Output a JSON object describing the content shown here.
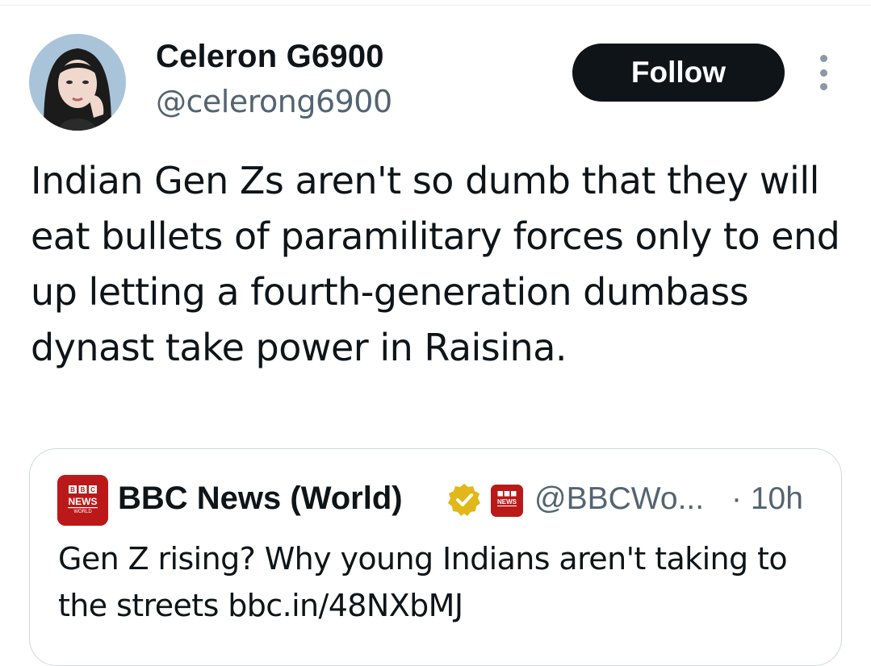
{
  "tweet": {
    "author": {
      "display_name": "Celeron G6900",
      "handle": "@celerong6900"
    },
    "follow_label": "Follow",
    "more_icon": "more-vertical-icon",
    "text": "Indian Gen Zs aren't so dumb that they will eat bullets of paramilitary forces only to end up letting a fourth-generation dumbass dynast take power in Raisina."
  },
  "quoted_tweet": {
    "author": {
      "display_name": "BBC News (World)",
      "handle": "@BBCWo...",
      "verified_icon": "gold-verified-badge-icon"
    },
    "logo_lettering": [
      "BBC",
      "NEWS",
      "WORLD"
    ],
    "timestamp": "· 10h",
    "text": "Gen Z rising? Why young Indians aren't taking to the streets bbc.in/48NXbMJ"
  },
  "colors": {
    "text_primary": "#0f1419",
    "text_secondary": "#536471",
    "follow_button_bg": "#0f1419",
    "bbc_red": "#bb1919",
    "verified_gold": "#e2b719",
    "border": "#cfd9de"
  }
}
